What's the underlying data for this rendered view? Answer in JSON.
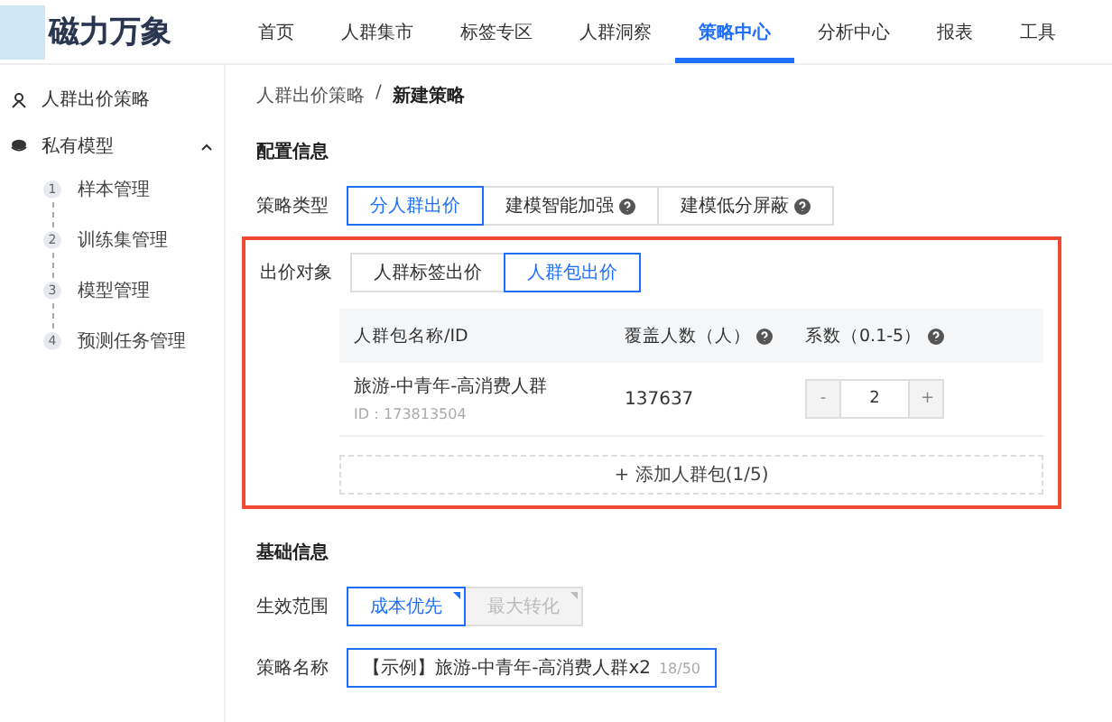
{
  "brand": {
    "name": "磁力万象"
  },
  "nav": [
    {
      "label": "首页",
      "selected": false
    },
    {
      "label": "人群集市",
      "selected": false
    },
    {
      "label": "标签专区",
      "selected": false
    },
    {
      "label": "人群洞察",
      "selected": false
    },
    {
      "label": "策略中心",
      "selected": true
    },
    {
      "label": "分析中心",
      "selected": false
    },
    {
      "label": "报表",
      "selected": false
    },
    {
      "label": "工具",
      "selected": false
    }
  ],
  "sidebar": {
    "items": [
      {
        "label": "人群出价策略",
        "kind": "link"
      },
      {
        "label": "私有模型",
        "kind": "group",
        "expanded": true,
        "children": [
          {
            "step": "1",
            "label": "样本管理"
          },
          {
            "step": "2",
            "label": "训练集管理"
          },
          {
            "step": "3",
            "label": "模型管理"
          },
          {
            "step": "4",
            "label": "预测任务管理"
          }
        ]
      }
    ]
  },
  "breadcrumb": {
    "parent": "人群出价策略",
    "separator": "/",
    "current": "新建策略"
  },
  "config": {
    "title": "配置信息",
    "strategy_type": {
      "label": "策略类型",
      "options": [
        {
          "label": "分人群出价",
          "selected": true,
          "help": false
        },
        {
          "label": "建模智能加强",
          "selected": false,
          "help": true
        },
        {
          "label": "建模低分屏蔽",
          "selected": false,
          "help": true
        }
      ]
    },
    "bid_target": {
      "label": "出价对象",
      "options": [
        {
          "label": "人群标签出价",
          "selected": false
        },
        {
          "label": "人群包出价",
          "selected": true
        }
      ],
      "table": {
        "columns": [
          {
            "label": "人群包名称/ID",
            "help": false
          },
          {
            "label": "覆盖人数（人）",
            "help": true
          },
          {
            "label": "系数（0.1-5）",
            "help": true
          }
        ],
        "rows": [
          {
            "name": "旅游-中青年-高消费人群",
            "id": "ID：173813504",
            "coverage": "137637",
            "stepper": {
              "minus": "-",
              "value": "2",
              "plus": "+"
            }
          }
        ]
      },
      "add_button": "+ 添加人群包(1/5)"
    }
  },
  "basic": {
    "title": "基础信息",
    "scope": {
      "label": "生效范围",
      "options": [
        {
          "label": "成本优先",
          "selected": true,
          "disabled": false
        },
        {
          "label": "最大转化",
          "selected": false,
          "disabled": true
        }
      ]
    },
    "name": {
      "label": "策略名称",
      "value": "【示例】旅游-中青年-高消费人群x2",
      "count": "18/50"
    }
  }
}
